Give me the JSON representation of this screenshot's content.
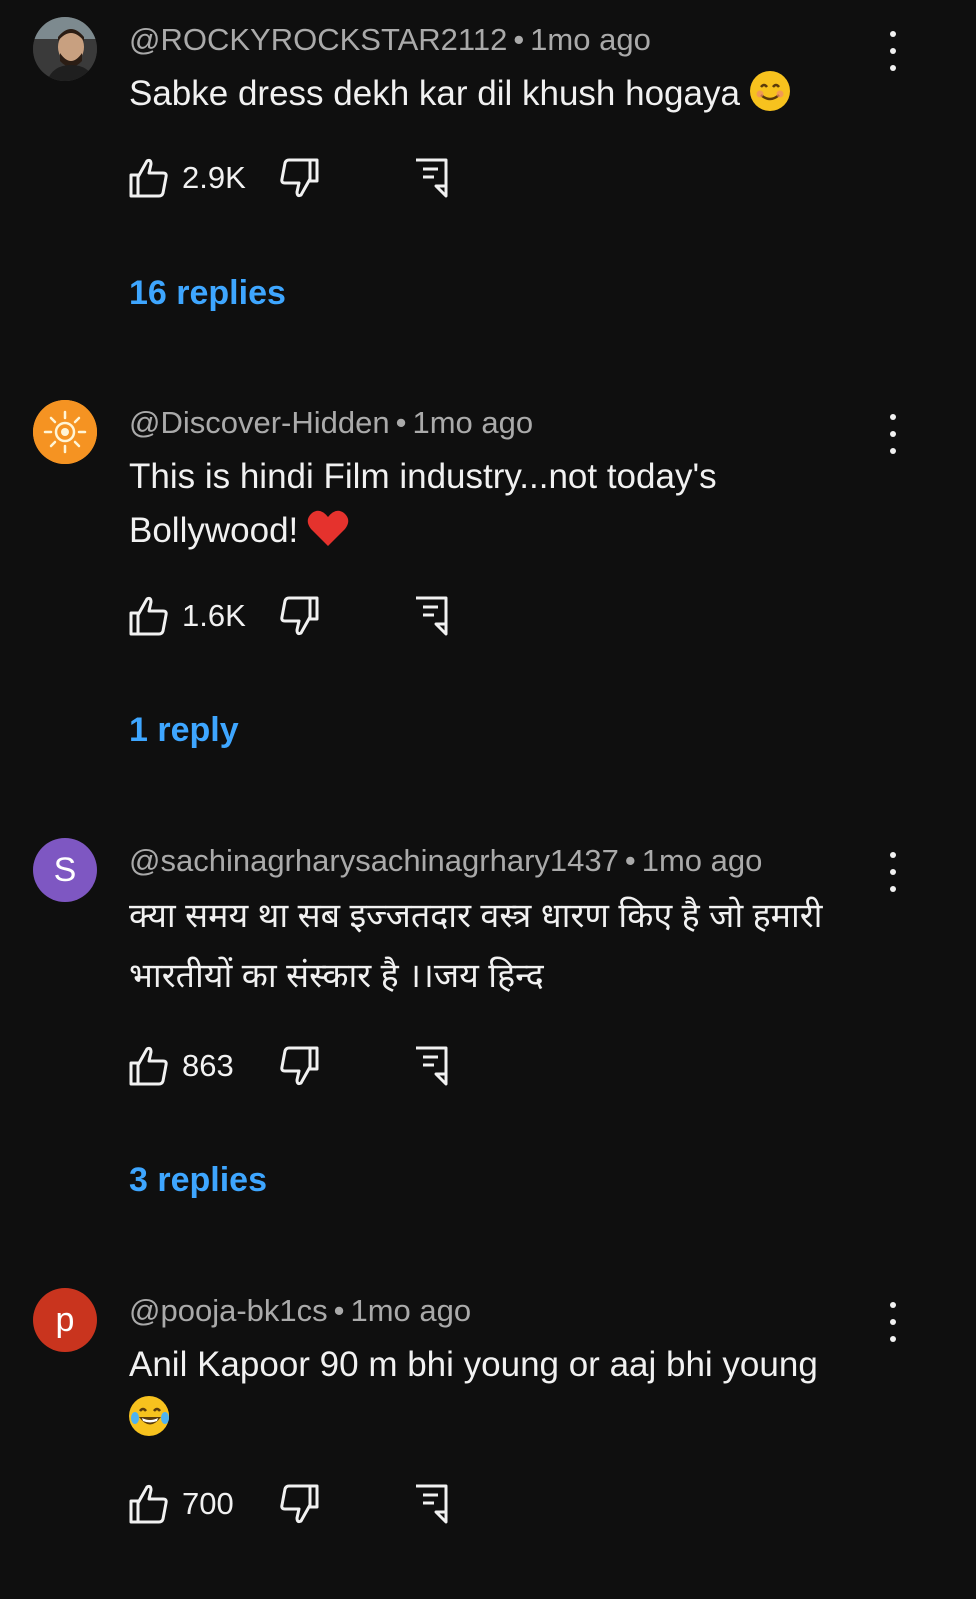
{
  "comments": [
    {
      "author": "@ROCKYROCKSTAR2112",
      "time": "1mo ago",
      "text": "Sabke dress dekh kar dil khush hogaya",
      "text_lines": [
        "Sabke dress dekh kar dil khush hogaya"
      ],
      "emoji": "smiling-face",
      "likes": "2.9K",
      "replies": "16 replies",
      "avatar": "photo"
    },
    {
      "author": "@Discover-Hidden",
      "time": "1mo ago",
      "text_lines": [
        "This is hindi Film industry...not today's",
        "Bollywood!"
      ],
      "emoji": "red-heart",
      "likes": "1.6K",
      "replies": "1 reply",
      "avatar": "sun-logo"
    },
    {
      "author": "@sachinagrharysachinagrhary1437",
      "time": "1mo ago",
      "text_lines": [
        "क्या समय था सब इज्जतदार वस्त्र धारण किए है जो हमारी",
        "भारतीयों का संस्कार है ।।जय हिन्द"
      ],
      "likes": "863",
      "replies": "3 replies",
      "avatar_letter": "S",
      "avatar_color": "#7e57c2"
    },
    {
      "author": "@pooja-bk1cs",
      "time": "1mo ago",
      "text_lines": [
        "Anil Kapoor 90 m bhi young or aaj bhi young"
      ],
      "emoji": "face-with-tears-of-joy",
      "likes": "700",
      "avatar_letter": "p",
      "avatar_color": "#c9341e"
    }
  ],
  "separator": "•",
  "colors": {
    "background": "#0f0f0f",
    "text": "#f1f1f1",
    "meta": "#aaaaaa",
    "link": "#3ea6ff"
  }
}
